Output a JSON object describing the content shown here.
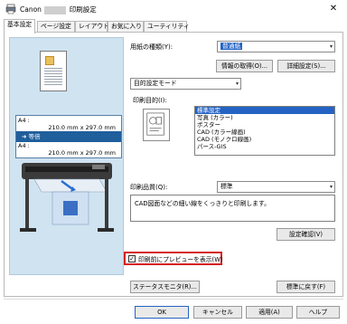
{
  "window": {
    "title_prefix": "Canon",
    "title_suffix": "印刷設定",
    "close_glyph": "✕"
  },
  "tabs": [
    {
      "label": "基本設定",
      "active": true
    },
    {
      "label": "ページ設定",
      "active": false
    },
    {
      "label": "レイアウト",
      "active": false
    },
    {
      "label": "お気に入り",
      "active": false
    },
    {
      "label": "ユーティリティ",
      "active": false
    }
  ],
  "preview": {
    "input_label": "A4 :",
    "input_size": "210.0 mm x 297.0 mm",
    "scale_label": "➜ 等倍",
    "output_label": "A4 :",
    "output_size": "210.0 mm x 297.0 mm"
  },
  "media": {
    "label": "用紙の種類(Y):",
    "value": "普通紙",
    "info_button": "情報の取得(O)...",
    "detail_button": "詳細設定(S)..."
  },
  "mode": {
    "value": "目的設定モード"
  },
  "purpose": {
    "label": "印刷目的(I):",
    "items": [
      "標準設定",
      "写真 (カラー)",
      "ポスター",
      "CAD (カラー線画)",
      "CAD (モノクロ線画)",
      "パース-GIS"
    ],
    "selected_index": 0
  },
  "quality": {
    "label": "印刷品質(Q):",
    "value": "標準",
    "description": "CAD図面などの細い線をくっきりと印刷します。",
    "confirm_button": "設定確認(V)"
  },
  "preview_option": {
    "label": "印刷前にプレビューを表示(W)",
    "checked": true,
    "check_glyph": "✓"
  },
  "buttons": {
    "status_monitor": "ステータスモニタ(R)...",
    "defaults": "標準に戻す(F)",
    "ok": "OK",
    "cancel": "キャンセル",
    "apply": "適用(A)",
    "help": "ヘルプ"
  },
  "colors": {
    "accent": "#2463c4",
    "highlight_border": "#d61f1f",
    "preview_bg": "#cfe3f1"
  },
  "icons": {
    "dropdown": "▾"
  }
}
